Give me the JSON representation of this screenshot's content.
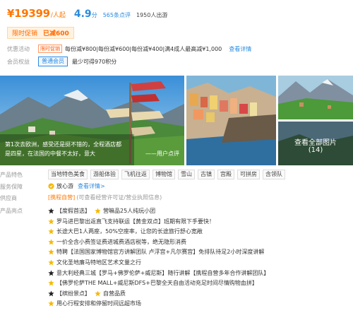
{
  "header": {
    "price": "¥19399",
    "price_unit": "/人起",
    "score": "4.9",
    "score_unit": "分",
    "review_count": "565条点评",
    "departed": "1950人出游"
  },
  "promo": {
    "tag": "限时促销",
    "saved": "已减600"
  },
  "discount": {
    "label": "优惠活动",
    "tag": "限时促销",
    "text": "每份减¥800|每份减¥600|每份减¥400|满4成人最高减¥1,000",
    "link": "查看详情"
  },
  "member": {
    "label": "会员权益",
    "tag": "普通会员",
    "text": "最少可得970积分"
  },
  "gallery": {
    "caption": "第1次去欧洲，感受还是挺不错的，全程酒店都是四星，在法国的中餐不太好，意大",
    "caption_src": "——用户点评",
    "view_all": "查看全部图片",
    "count": "(14)"
  },
  "features_tags": {
    "label": "产品特色",
    "items": [
      "当地特色美食",
      "游船体验",
      "飞机往返",
      "博物馆",
      "雪山",
      "古镇",
      "宫殿",
      "可拼房",
      "含领队"
    ]
  },
  "service": {
    "label": "服务保障",
    "text": "放心游",
    "link": "查看详情>"
  },
  "supplier": {
    "label": "供应商",
    "name": "[携程自营]",
    "note": "(可查看经营许可证/营业执照信息)"
  },
  "highlights": {
    "label": "产品亮点",
    "items": [
      {
        "icon": "black",
        "text": "【度假首选】",
        "icon2": "yellow",
        "text2": "营嘛品25人纯玩小团"
      },
      {
        "icon": "yellow",
        "text": "罗马进巴黎出返直飞支持联运【黄金双点】班期有限下手要快！"
      },
      {
        "icon": "yellow",
        "text": "长途大巴1人两座，50%空座率，让您的长途旅行舒心宽敞"
      },
      {
        "icon": "yellow",
        "text": "一价全含小费签证费进城费酒店税等，绝无隐形消费"
      },
      {
        "icon": "yellow",
        "text": "特聘【法国国家博物馆官方讲解团队 卢浮宫+凡尔赛宫】免排队待足2小时深度讲解"
      },
      {
        "icon": "yellow",
        "text": "文化圣地廉马特地区艺术文量之行"
      },
      {
        "icon": "black",
        "text": "意大利经典三城【罗马+佛罗伦萨+威尼斯】随行讲解【携程自营多年合作讲解团队】"
      },
      {
        "icon": "yellow",
        "text": "【佛罗伦萨THE MALL+威尼斯DFS+巴黎全天自由活动充足时间尽情购物血拼】"
      },
      {
        "icon": "black",
        "text": "【缤纷景点】",
        "icon2": "yellow",
        "text2": "自营品质"
      },
      {
        "icon": "yellow",
        "text": "用心行程安排和停留时间远超市场"
      }
    ]
  },
  "colors": {
    "accent": "#ff7700",
    "link": "#2a8be0",
    "star": "#f5b800"
  }
}
